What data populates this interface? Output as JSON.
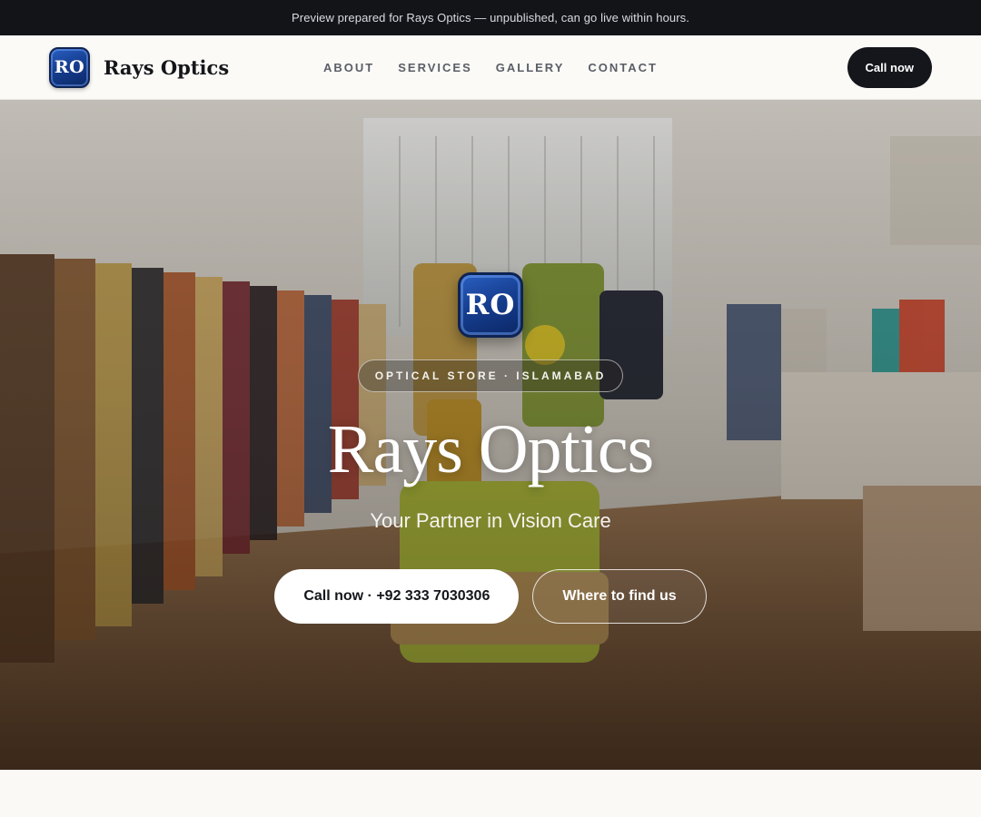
{
  "preview_bar": {
    "text": "Preview prepared for Rays Optics — unpublished, can go live within hours."
  },
  "navbar": {
    "logo_initials": "RO",
    "brand_name": "Rays Optics",
    "links": [
      "ABOUT",
      "SERVICES",
      "GALLERY",
      "CONTACT"
    ],
    "cta_label": "Call now"
  },
  "hero": {
    "logo_initials": "RO",
    "tag": "OPTICAL STORE · ISLAMABAD",
    "title": "Rays Optics",
    "subtitle": "Your Partner in Vision Care",
    "primary_button": "Call now · +92 333 7030306",
    "secondary_button": "Where to find us"
  },
  "colors": {
    "dark": "#14161b",
    "brand_blue": "#163f91",
    "page_bg": "#faf9f6"
  }
}
